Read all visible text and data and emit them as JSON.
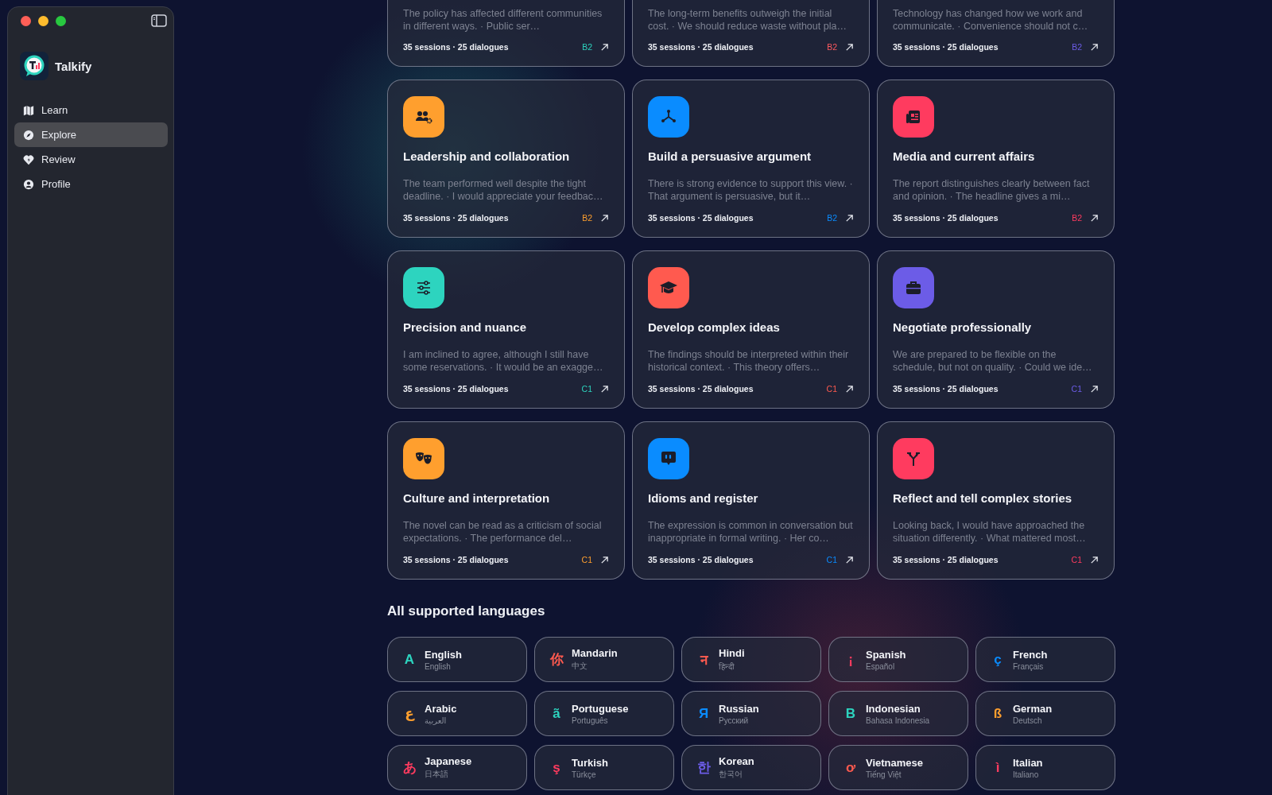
{
  "app": {
    "name": "Talkify"
  },
  "nav": [
    {
      "label": "Learn",
      "selected": false
    },
    {
      "label": "Explore",
      "selected": true
    },
    {
      "label": "Review",
      "selected": false
    },
    {
      "label": "Profile",
      "selected": false
    }
  ],
  "cards": [
    {
      "description": "The policy has affected different communities in different ways. · Public ser…",
      "meta": "35 sessions · 25 dialogues",
      "level": "B2",
      "color": "#2dd4bf"
    },
    {
      "description": "The long-term benefits outweigh the initial cost. · We should reduce waste without pla…",
      "meta": "35 sessions · 25 dialogues",
      "level": "B2",
      "color": "#ff5a5f"
    },
    {
      "description": "Technology has changed how we work and communicate. · Convenience should not c…",
      "meta": "35 sessions · 25 dialogues",
      "level": "B2",
      "color": "#6c5ce7"
    },
    {
      "title": "Leadership and collaboration",
      "description": "The team performed well despite the tight deadline. · I would appreciate your feedbac…",
      "meta": "35 sessions · 25 dialogues",
      "level": "B2",
      "color": "#ff9f2e"
    },
    {
      "title": "Build a persuasive argument",
      "description": "There is strong evidence to support this view. · That argument is persuasive, but it…",
      "meta": "35 sessions · 25 dialogues",
      "level": "B2",
      "color": "#0a8cff"
    },
    {
      "title": "Media and current affairs",
      "description": "The report distinguishes clearly between fact and opinion. · The headline gives a mi…",
      "meta": "35 sessions · 25 dialogues",
      "level": "B2",
      "color": "#ff3b5f"
    },
    {
      "title": "Precision and nuance",
      "description": "I am inclined to agree, although I still have some reservations. · It would be an exagge…",
      "meta": "35 sessions · 25 dialogues",
      "level": "C1",
      "color": "#2dd4bf"
    },
    {
      "title": "Develop complex ideas",
      "description": "The findings should be interpreted within their historical context. · This theory offers…",
      "meta": "35 sessions · 25 dialogues",
      "level": "C1",
      "color": "#ff5a4f"
    },
    {
      "title": "Negotiate professionally",
      "description": "We are prepared to be flexible on the schedule, but not on quality. · Could we ide…",
      "meta": "35 sessions · 25 dialogues",
      "level": "C1",
      "color": "#6c5ce7"
    },
    {
      "title": "Culture and interpretation",
      "description": "The novel can be read as a criticism of social expectations. · The performance del…",
      "meta": "35 sessions · 25 dialogues",
      "level": "C1",
      "color": "#ff9f2e"
    },
    {
      "title": "Idioms and register",
      "description": "The expression is common in conversation but inappropriate in formal writing. · Her co…",
      "meta": "35 sessions · 25 dialogues",
      "level": "C1",
      "color": "#0a8cff"
    },
    {
      "title": "Reflect and tell complex stories",
      "description": "Looking back, I would have approached the situation differently. · What mattered most…",
      "meta": "35 sessions · 25 dialogues",
      "level": "C1",
      "color": "#ff3b5f"
    }
  ],
  "languages_section": {
    "title": "All supported languages"
  },
  "languages": [
    {
      "glyph": "A",
      "name": "English",
      "native": "English",
      "color": "#2dd4bf"
    },
    {
      "glyph": "你",
      "name": "Mandarin",
      "native": "中文",
      "color": "#ff5a4f"
    },
    {
      "glyph": "न",
      "name": "Hindi",
      "native": "हिन्दी",
      "color": "#ff5a4f"
    },
    {
      "glyph": "¡",
      "name": "Spanish",
      "native": "Español",
      "color": "#ff3b5f"
    },
    {
      "glyph": "ç",
      "name": "French",
      "native": "Français",
      "color": "#0a8cff"
    },
    {
      "glyph": "ع",
      "name": "Arabic",
      "native": "العربية",
      "color": "#ff9f2e"
    },
    {
      "glyph": "ã",
      "name": "Portuguese",
      "native": "Português",
      "color": "#2dd4bf"
    },
    {
      "glyph": "Я",
      "name": "Russian",
      "native": "Русский",
      "color": "#0a8cff"
    },
    {
      "glyph": "B",
      "name": "Indonesian",
      "native": "Bahasa Indonesia",
      "color": "#2dd4bf"
    },
    {
      "glyph": "ß",
      "name": "German",
      "native": "Deutsch",
      "color": "#ff9f2e"
    },
    {
      "glyph": "あ",
      "name": "Japanese",
      "native": "日本語",
      "color": "#ff3b5f"
    },
    {
      "glyph": "ş",
      "name": "Turkish",
      "native": "Türkçe",
      "color": "#ff3b5f"
    },
    {
      "glyph": "한",
      "name": "Korean",
      "native": "한국어",
      "color": "#6c5ce7"
    },
    {
      "glyph": "ơ",
      "name": "Vietnamese",
      "native": "Tiếng Việt",
      "color": "#ff5a4f"
    },
    {
      "glyph": "ì",
      "name": "Italian",
      "native": "Italiano",
      "color": "#ff3b5f"
    }
  ]
}
